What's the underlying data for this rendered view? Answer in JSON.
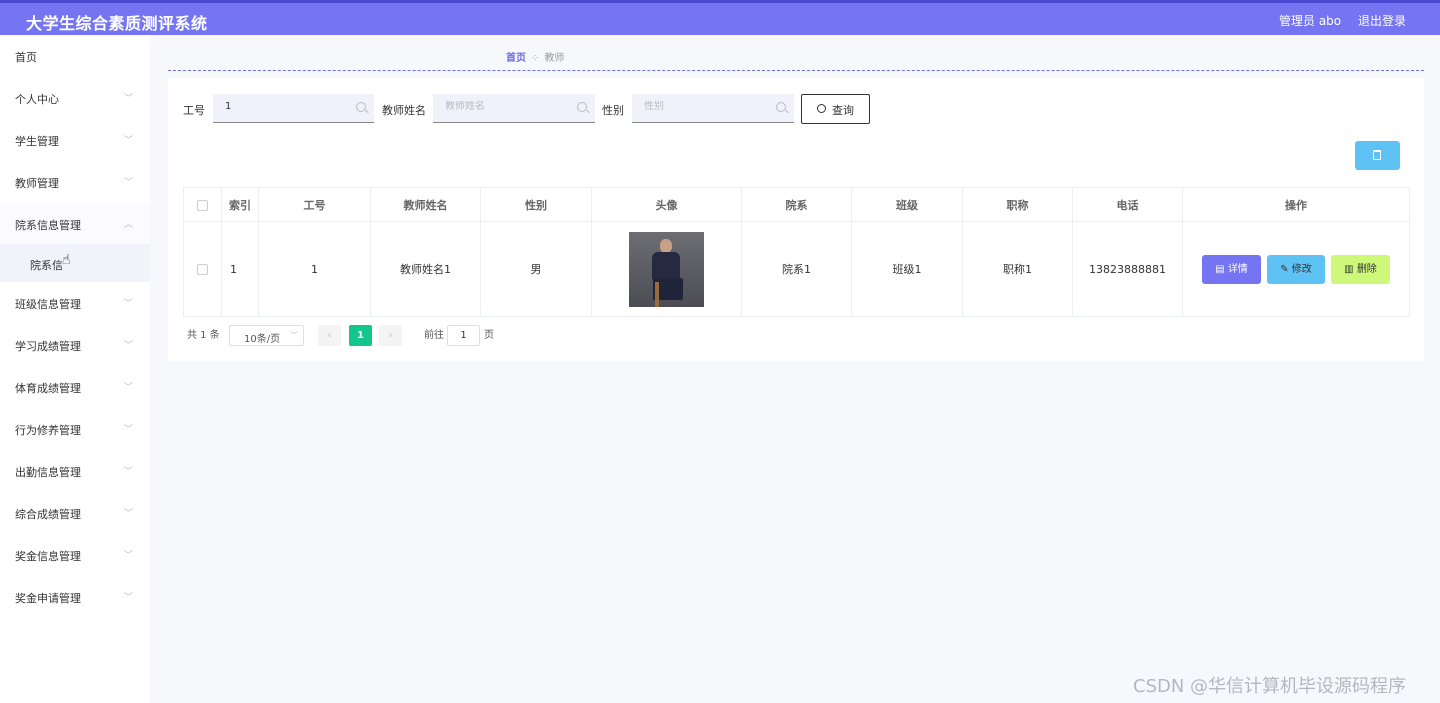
{
  "app": {
    "title": "大学生综合素质测评系统",
    "user": "管理员 abo",
    "logout": "退出登录"
  },
  "sidebar": {
    "items": [
      {
        "label": "首页",
        "chevron": ""
      },
      {
        "label": "个人中心",
        "chevron": "﹀"
      },
      {
        "label": "学生管理",
        "chevron": "﹀"
      },
      {
        "label": "教师管理",
        "chevron": "﹀"
      },
      {
        "label": "院系信息管理",
        "chevron": "︿"
      },
      {
        "label": "班级信息管理",
        "chevron": "﹀"
      },
      {
        "label": "学习成绩管理",
        "chevron": "﹀"
      },
      {
        "label": "体育成绩管理",
        "chevron": "﹀"
      },
      {
        "label": "行为修养管理",
        "chevron": "﹀"
      },
      {
        "label": "出勤信息管理",
        "chevron": "﹀"
      },
      {
        "label": "综合成绩管理",
        "chevron": "﹀"
      },
      {
        "label": "奖金信息管理",
        "chevron": "﹀"
      },
      {
        "label": "奖金申请管理",
        "chevron": "﹀"
      }
    ],
    "submenu_label": "院系信"
  },
  "breadcrumb": {
    "home": "首页",
    "separator": "⁘",
    "current": "教师"
  },
  "filters": {
    "gonghao": {
      "label": "工号",
      "value": "1",
      "placeholder": ""
    },
    "name": {
      "label": "教师姓名",
      "value": "",
      "placeholder": "教师姓名"
    },
    "gender": {
      "label": "性别",
      "value": "",
      "placeholder": "性别"
    },
    "query_label": "查询"
  },
  "table": {
    "headers": [
      "",
      "索引",
      "工号",
      "教师姓名",
      "性别",
      "头像",
      "院系",
      "班级",
      "职称",
      "电话",
      "操作"
    ],
    "rows": [
      {
        "index": "1",
        "gonghao": "1",
        "name": "教师姓名1",
        "gender": "男",
        "dept": "院系1",
        "class": "班级1",
        "title": "职称1",
        "phone": "13823888881"
      }
    ],
    "actions": {
      "detail": "详情",
      "edit": "修改",
      "delete": "删除"
    }
  },
  "pagination": {
    "total": "共 1 条",
    "page_size": "10条/页",
    "prev": "‹",
    "current": "1",
    "next": "›",
    "goto_prefix": "前往",
    "goto_value": "1",
    "goto_suffix": "页"
  },
  "watermark": "CSDN @华信计算机毕设源码程序",
  "colors": {
    "accent": "#7575f3",
    "info": "#5ec2f4",
    "warning": "#cdf87a",
    "page_active": "#13c68c"
  }
}
